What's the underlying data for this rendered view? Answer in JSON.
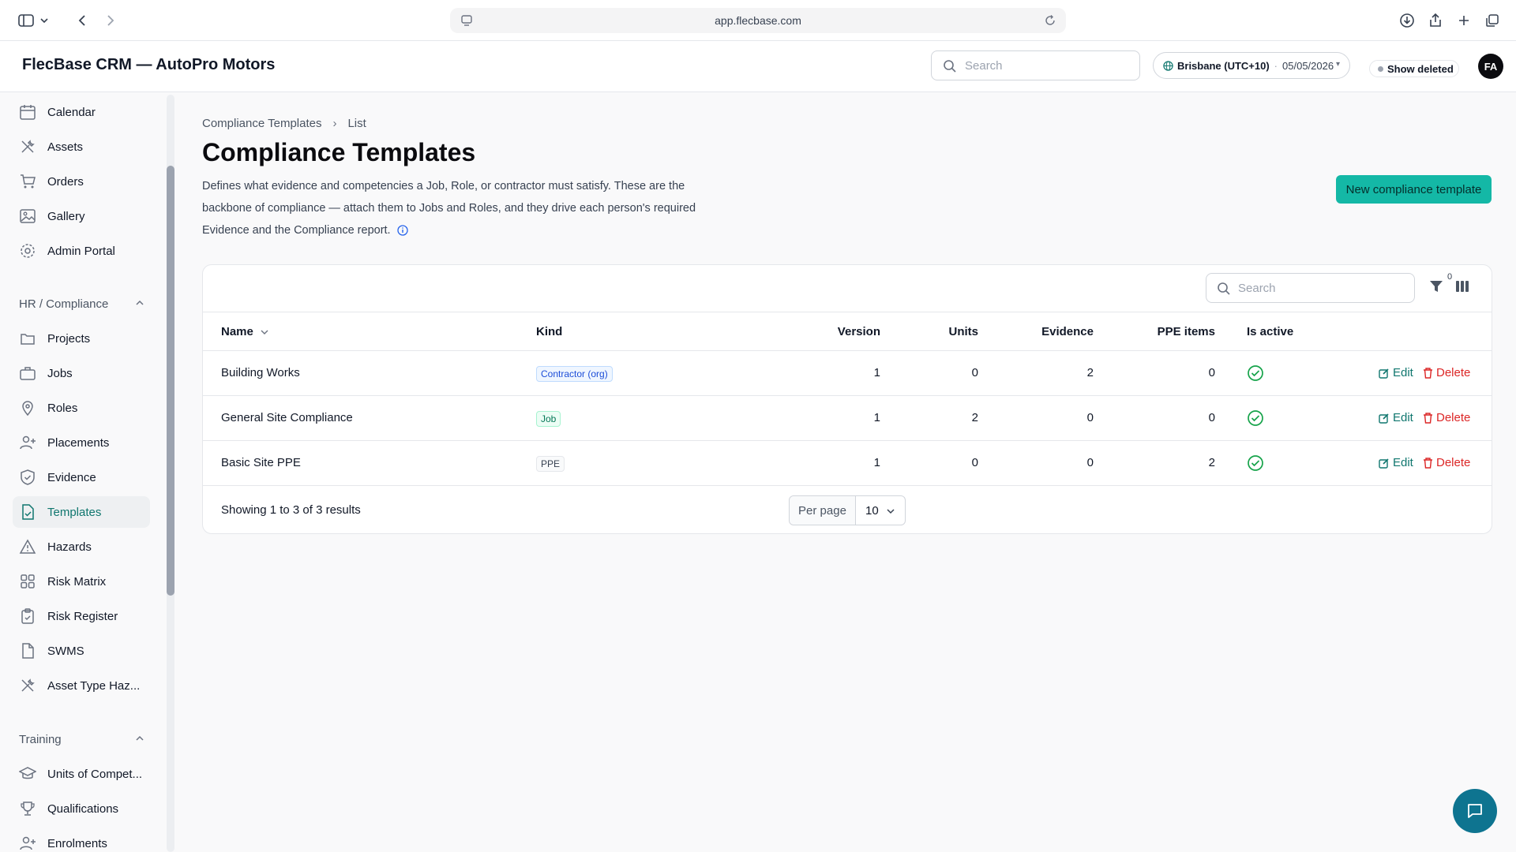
{
  "browser": {
    "url": "app.flecbase.com"
  },
  "header": {
    "title": "FlecBase CRM — AutoPro Motors",
    "search_placeholder": "Search",
    "timezone": "Brisbane (UTC+10)",
    "date": "05/05/2026",
    "show_deleted_label": "Show deleted",
    "avatar_initials": "FA"
  },
  "sidebar": {
    "top_items": [
      {
        "label": "Calendar",
        "icon": "calendar-icon"
      },
      {
        "label": "Assets",
        "icon": "tools-icon"
      },
      {
        "label": "Orders",
        "icon": "cart-icon"
      },
      {
        "label": "Gallery",
        "icon": "image-icon"
      },
      {
        "label": "Admin Portal",
        "icon": "gear-icon"
      }
    ],
    "sections": [
      {
        "title": "HR / Compliance",
        "items": [
          {
            "label": "Projects",
            "icon": "folders-icon"
          },
          {
            "label": "Jobs",
            "icon": "briefcase-icon"
          },
          {
            "label": "Roles",
            "icon": "pin-icon"
          },
          {
            "label": "Placements",
            "icon": "user-plus-icon"
          },
          {
            "label": "Evidence",
            "icon": "shield-check-icon"
          },
          {
            "label": "Templates",
            "icon": "file-check-icon",
            "active": true
          },
          {
            "label": "Hazards",
            "icon": "warning-icon"
          },
          {
            "label": "Risk Matrix",
            "icon": "grid-icon"
          },
          {
            "label": "Risk Register",
            "icon": "clipboard-icon"
          },
          {
            "label": "SWMS",
            "icon": "document-icon"
          },
          {
            "label": "Asset Type Haz...",
            "icon": "tools-icon"
          }
        ]
      },
      {
        "title": "Training",
        "items": [
          {
            "label": "Units of Compet...",
            "icon": "graduation-cap-icon"
          },
          {
            "label": "Qualifications",
            "icon": "trophy-icon"
          },
          {
            "label": "Enrolments",
            "icon": "user-plus-icon"
          }
        ]
      }
    ]
  },
  "main": {
    "breadcrumb": [
      "Compliance Templates",
      "List"
    ],
    "title": "Compliance Templates",
    "description": "Defines what evidence and competencies a Job, Role, or contractor must satisfy. These are the backbone of compliance — attach them to Jobs and Roles, and they drive each person's required Evidence and the Compliance report.",
    "new_button_label": "New compliance template",
    "table": {
      "search_placeholder": "Search",
      "filter_count": "0",
      "columns": [
        "Name",
        "Kind",
        "Version",
        "Units",
        "Evidence",
        "PPE items",
        "Is active"
      ],
      "rows": [
        {
          "name": "Building Works",
          "kind": "Contractor (org)",
          "kind_style": "contractor",
          "version": "1",
          "units": "0",
          "evidence": "2",
          "ppe_items": "0",
          "is_active": true
        },
        {
          "name": "General Site Compliance",
          "kind": "Job",
          "kind_style": "job",
          "version": "1",
          "units": "2",
          "evidence": "0",
          "ppe_items": "0",
          "is_active": true
        },
        {
          "name": "Basic Site PPE",
          "kind": "PPE",
          "kind_style": "ppe",
          "version": "1",
          "units": "0",
          "evidence": "0",
          "ppe_items": "2",
          "is_active": true
        }
      ],
      "edit_label": "Edit",
      "delete_label": "Delete",
      "summary": "Showing 1 to 3 of 3 results",
      "per_page_label": "Per page",
      "per_page_value": "10"
    }
  },
  "colors": {
    "accent": "#14b8a6",
    "active_nav": "#0f766e",
    "danger": "#dc2626",
    "success": "#16a34a",
    "chat": "#0e7490"
  }
}
